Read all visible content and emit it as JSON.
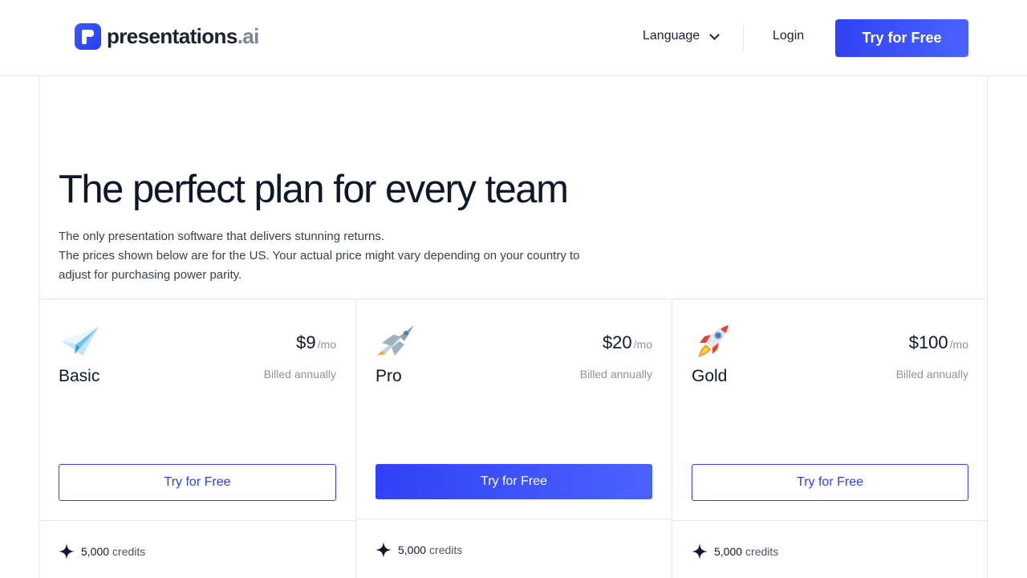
{
  "brand": {
    "name_main": "presentations",
    "name_dot": ".ai"
  },
  "nav": {
    "language": "Language",
    "login": "Login",
    "cta": "Try for Free"
  },
  "hero": {
    "title": "The perfect plan for every team",
    "line1": "The only presentation  software that delivers stunning returns.",
    "line2": "The prices shown below are for the US. Your actual price might vary depending on your country to",
    "line3": "adjust for purchasing power parity."
  },
  "plans": [
    {
      "name": "Basic",
      "icon": "paper-plane-icon",
      "price": "$9",
      "per": "/mo",
      "billed": "Billed annually",
      "cta": "Try for Free",
      "style": "outline",
      "credits_num": "5,000",
      "credits_label": "credits"
    },
    {
      "name": "Pro",
      "icon": "jet-icon",
      "price": "$20",
      "per": "/mo",
      "billed": "Billed annually",
      "cta": "Try for Free",
      "style": "filled",
      "credits_num": "5,000",
      "credits_label": "credits"
    },
    {
      "name": "Gold",
      "icon": "rocket-icon",
      "price": "$100",
      "per": "/mo",
      "billed": "Billed annually",
      "cta": "Try for Free",
      "style": "outline",
      "credits_num": "5,000",
      "credits_label": "credits"
    }
  ],
  "colors": {
    "accent": "#3042f5",
    "text": "#0f172a",
    "muted": "#8b93a1",
    "border": "#e5e9ef"
  }
}
